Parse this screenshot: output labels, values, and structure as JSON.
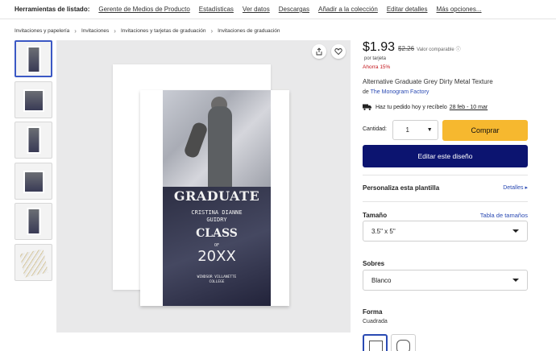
{
  "toolbar": {
    "label": "Herramientas de listado:",
    "links": [
      "Gerente de Medios de Producto",
      "Estadísticas",
      "Ver datos",
      "Descargas",
      "Añadir a la colección",
      "Editar detalles",
      "Más opciones..."
    ]
  },
  "breadcrumb": [
    "Invitaciones y papelería",
    "Invitaciones",
    "Invitaciones y tarjetas de graduación",
    "Invitaciones de graduación"
  ],
  "card": {
    "title": "GRADUATE",
    "name_line1": "CRISTINA DIANNE",
    "name_line2": "GUIDRY",
    "class_word": "CLASS",
    "of_word": "OF",
    "year": "20XX",
    "college_line1": "WINDSOR VILLANETTE",
    "college_line2": "COLLEGE"
  },
  "product": {
    "price": "$1.93",
    "price_old": "$2.26",
    "compare_label": "Valor comparable",
    "per": "por tarjeta",
    "save": "Ahorra 15%",
    "name": "Alternative Graduate Grey Dirty Metal Texture",
    "by": "de",
    "brand": "The Monogram Factory",
    "ship_text": "Haz tu pedido hoy y recíbelo",
    "ship_date": "28 feb - 10 mar"
  },
  "purchase": {
    "qty_label": "Cantidad:",
    "qty_value": "1",
    "buy_label": "Comprar",
    "edit_label": "Editar este diseño"
  },
  "personalize": {
    "title": "Personaliza esta plantilla",
    "details_label": "Detalles"
  },
  "options": {
    "size_label": "Tamaño",
    "size_chart": "Tabla de tamaños",
    "size_value": "3.5\" x 5\"",
    "envelope_label": "Sobres",
    "envelope_value": "Blanco",
    "shape_label": "Forma",
    "shape_value": "Cuadrada"
  },
  "colors": {
    "buy": "#f6b82f",
    "edit": "#0c1470",
    "link": "#2a4ab3",
    "save": "#c4161c"
  }
}
